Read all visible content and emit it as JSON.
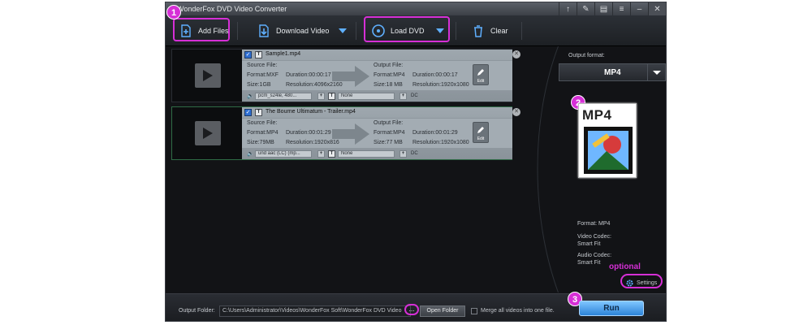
{
  "window": {
    "title": "WonderFox DVD Video Converter"
  },
  "titlebar_buttons": [
    "upload-icon",
    "brush-icon",
    "chat-icon",
    "menu-icon",
    "minimize-icon",
    "close-icon"
  ],
  "toolbar": {
    "add_files": "Add Files",
    "download_video": "Download Video",
    "load_dvd": "Load DVD",
    "clear": "Clear"
  },
  "annotations": {
    "step1": "1",
    "step2": "2",
    "step3": "3",
    "optional": "optional",
    "highlight_color": "#d62fd6"
  },
  "files": [
    {
      "name": "Sample1.mp4",
      "source_label": "Source File:",
      "source_format": "Format:MXF",
      "source_duration": "Duration:00:00:17",
      "source_size": "Size:1GB",
      "source_resolution": "Resolution:4096x2160",
      "output_label": "Output File:",
      "output_format": "Format:MP4",
      "output_duration": "Duration:00:00:17",
      "output_size": "Size:18 MB",
      "output_resolution": "Resolution:1920x1080",
      "edit_label": "Edit",
      "audio_track": "pcm_s24le, 480...",
      "subtitle": "None",
      "tag": "DC"
    },
    {
      "name": "The Bourne Ultimatum - Trailer.mp4",
      "source_label": "Source File:",
      "source_format": "Format:MP4",
      "source_duration": "Duration:00:01:29",
      "source_size": "Size:79MB",
      "source_resolution": "Resolution:1920x816",
      "output_label": "Output File:",
      "output_format": "Format:MP4",
      "output_duration": "Duration:00:01:29",
      "output_size": "Size:77 MB",
      "output_resolution": "Resolution:1920x1080",
      "edit_label": "Edit",
      "audio_track": "und aac (LC) (mp...",
      "subtitle": "None",
      "tag": "DC"
    }
  ],
  "output": {
    "label": "Output format:",
    "format": "MP4",
    "icon_text": "MP4",
    "format_line": "Format: MP4",
    "video_codec_label": "Video Codec:",
    "video_codec_value": "Smart Fit",
    "audio_codec_label": "Audio Codec:",
    "audio_codec_value": "Smart Fit",
    "settings": "Settings"
  },
  "bottom": {
    "output_folder_label": "Output Folder:",
    "output_folder_path": "C:\\Users\\Administrator\\Videos\\WonderFox Soft\\WonderFox DVD Video",
    "browse": "...",
    "open_folder": "Open Folder",
    "merge_label": "Merge all videos into one file.",
    "run": "Run"
  }
}
